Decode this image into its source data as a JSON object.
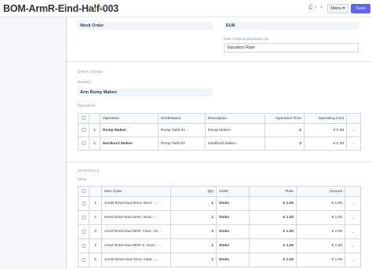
{
  "header": {
    "title": "BOM-ArmR-Eind-Half-003",
    "status": "Default",
    "print_icon": "⎙",
    "prev_icon": "‹",
    "next_icon": "›",
    "menu_label": "Menu ▾",
    "save_label": "Save"
  },
  "costing": {
    "work_order_value": "Work Order",
    "currency_value": "EUR",
    "rate_basis_label": "Rate Of Materials Based On",
    "rate_basis_value": "Valuation Rate"
  },
  "operations_section": {
    "title": "OPERATIONS",
    "routing_label": "Routing",
    "routing_value": "Arm Romp Maken",
    "table_label": "Operations",
    "columns": [
      "Operation",
      "Workstation",
      "Description",
      "Operation Time",
      "Operating Cost"
    ],
    "rows": [
      {
        "idx": "1",
        "operation": "Romp Maken",
        "workstation": "Romp Tafel 01",
        "description": "Romp Maken",
        "time": "2",
        "cost": "€ 0.39"
      },
      {
        "idx": "2",
        "operation": "Hardbord Maken",
        "workstation": "Romp Tafel 02",
        "description": "Hardbord Maken",
        "time": "2",
        "cost": "€ 0.39"
      }
    ]
  },
  "materials_section": {
    "title": "MATERIALS",
    "table_label": "Items",
    "columns": [
      "Item Code",
      "Qty",
      "UOM",
      "Rate",
      "Amount"
    ],
    "rows": [
      {
        "idx": "1",
        "item": "ArmB-Eind-Hout-3mm: Hout - ...",
        "qty": "1",
        "uom": "Stuks",
        "rate": "€ 1.00",
        "amount": "€ 1.00"
      },
      {
        "idx": "2",
        "item": "ArmV-Eind-Hout-3mm: Hout - ...",
        "qty": "1",
        "uom": "Stuks",
        "rate": "€ 1.00",
        "amount": "€ 1.00"
      },
      {
        "idx": "3",
        "item": "ArmZ-Eind-Hout-MDF: Hout - Ei...",
        "qty": "2",
        "uom": "Stuks",
        "rate": "€ 1.00",
        "amount": "€ 2.00"
      },
      {
        "idx": "4",
        "item": "ArmZ-Eind-Hout-MDF-1: Hout - ...",
        "qty": "1",
        "uom": "Stuks",
        "rate": "€ 1.00",
        "amount": "€ 1.00"
      },
      {
        "idx": "5",
        "item": "ArmO-Eind-Hout-3mm: Hout - ...",
        "qty": "1",
        "uom": "Stuks",
        "rate": "€ 1.00",
        "amount": "€ 1.00"
      }
    ]
  }
}
